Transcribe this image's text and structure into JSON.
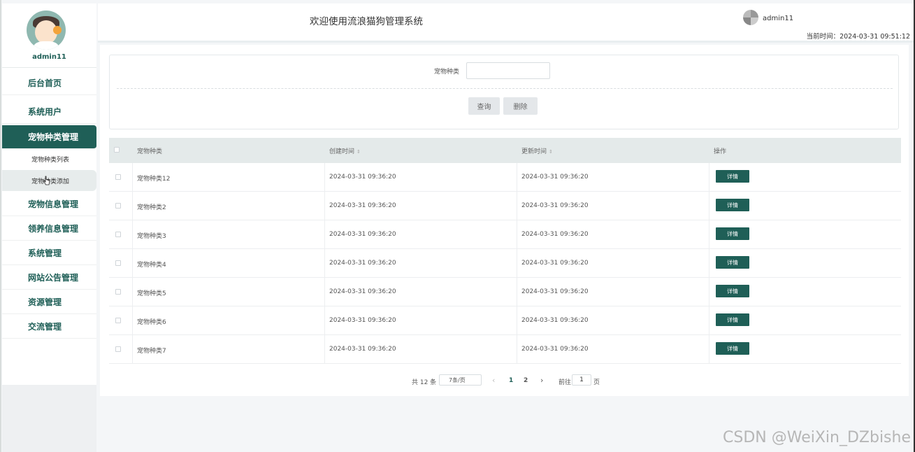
{
  "app": {
    "title": "欢迎使用流浪猫狗管理系统",
    "user": "admin11",
    "time_label": "当前时间：",
    "time_value": "2024-03-31 09:51:12"
  },
  "sidebar": {
    "user_name": "admin11",
    "items": [
      {
        "label": "后台首页"
      },
      {
        "label": "系统用户"
      },
      {
        "label": "宠物种类管理"
      },
      {
        "label": "宠物信息管理"
      },
      {
        "label": "领养信息管理"
      },
      {
        "label": "系统管理"
      },
      {
        "label": "网站公告管理"
      },
      {
        "label": "资源管理"
      },
      {
        "label": "交流管理"
      }
    ],
    "submenu": [
      {
        "label": "宠物种类列表"
      },
      {
        "label": "宠物种类添加"
      }
    ]
  },
  "search": {
    "label": "宠物种类",
    "value": "",
    "query_button": "查询",
    "delete_button": "删除"
  },
  "table": {
    "headers": [
      "宠物种类",
      "创建时间",
      "更新时间",
      "操作"
    ],
    "sort_icon": "⇕",
    "rows": [
      {
        "type": "宠物种类12",
        "created": "2024-03-31 09:36:20",
        "updated": "2024-03-31 09:36:20",
        "action": "详情"
      },
      {
        "type": "宠物种类2",
        "created": "2024-03-31 09:36:20",
        "updated": "2024-03-31 09:36:20",
        "action": "详情"
      },
      {
        "type": "宠物种类3",
        "created": "2024-03-31 09:36:20",
        "updated": "2024-03-31 09:36:20",
        "action": "详情"
      },
      {
        "type": "宠物种类4",
        "created": "2024-03-31 09:36:20",
        "updated": "2024-03-31 09:36:20",
        "action": "详情"
      },
      {
        "type": "宠物种类5",
        "created": "2024-03-31 09:36:20",
        "updated": "2024-03-31 09:36:20",
        "action": "详情"
      },
      {
        "type": "宠物种类6",
        "created": "2024-03-31 09:36:20",
        "updated": "2024-03-31 09:36:20",
        "action": "详情"
      },
      {
        "type": "宠物种类7",
        "created": "2024-03-31 09:36:20",
        "updated": "2024-03-31 09:36:20",
        "action": "详情"
      }
    ]
  },
  "pagination": {
    "total": "共 12 条",
    "page_size": "7条/页",
    "prev": "‹",
    "pages": [
      "1",
      "2"
    ],
    "next": "›",
    "goto_label": "前往",
    "goto_value": "1",
    "goto_unit": "页"
  },
  "watermark": "CSDN @WeiXin_DZbishe",
  "colors": {
    "accent": "#1f5f57",
    "header_bg": "#e4eaea"
  }
}
